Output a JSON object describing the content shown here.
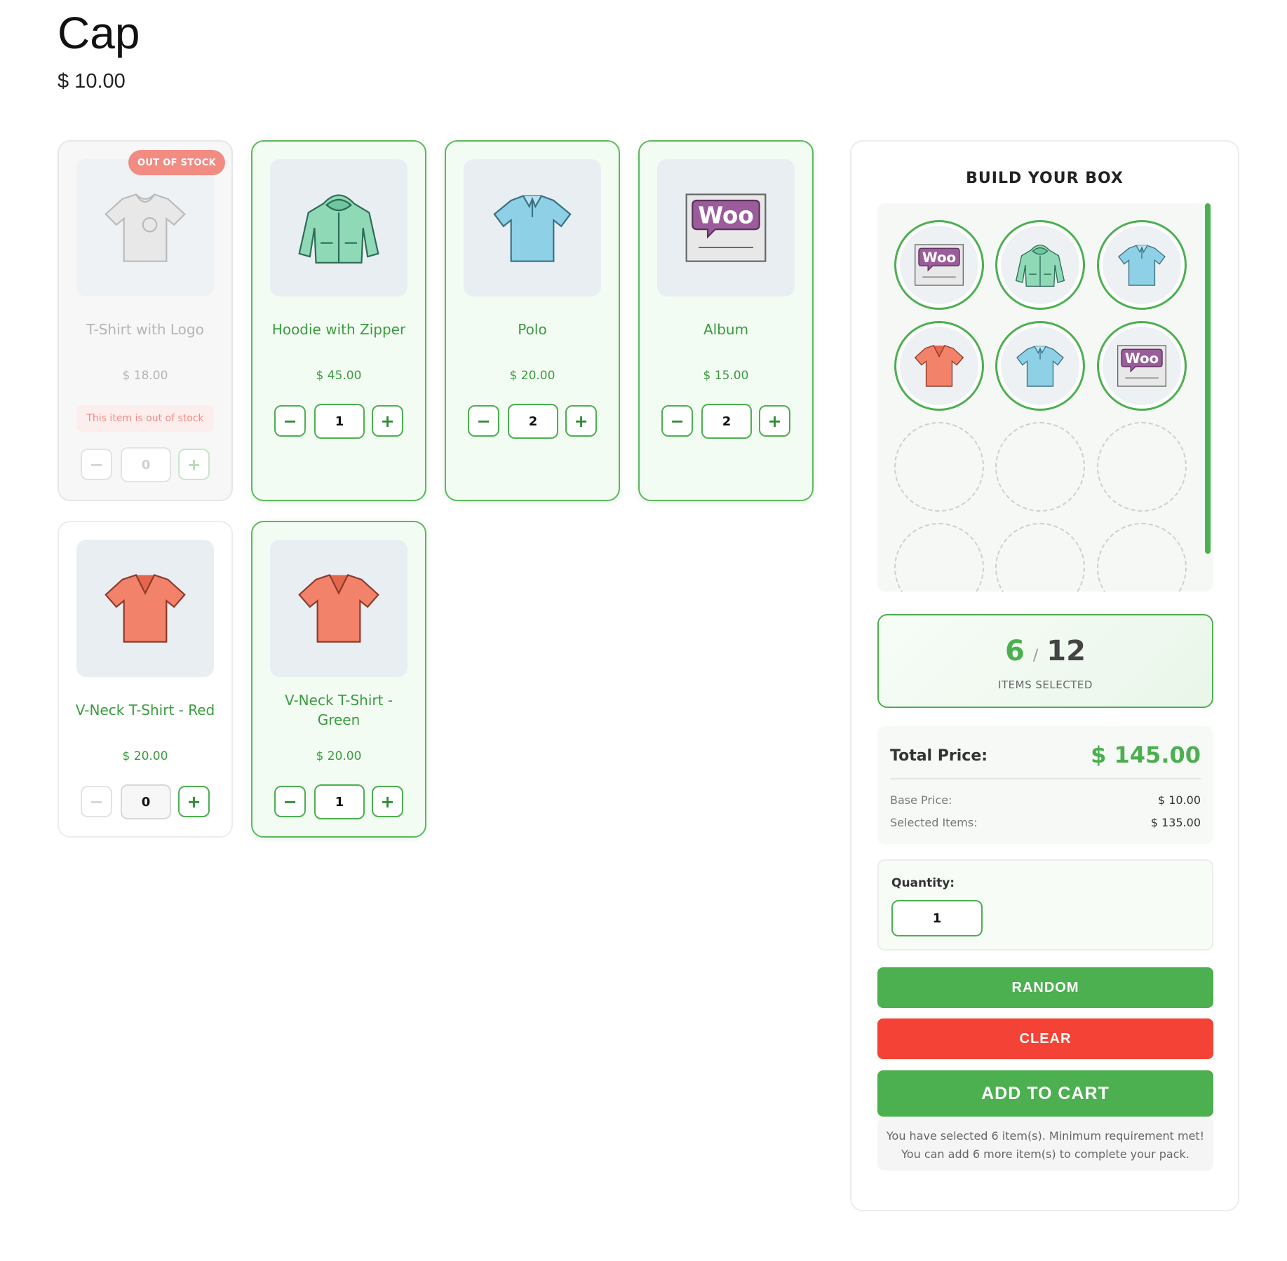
{
  "product": {
    "title": "Cap",
    "price": "$ 10.00"
  },
  "items": [
    {
      "name": "T-Shirt with Logo",
      "price": "$ 18.00",
      "qty": "0",
      "badge": "OUT OF STOCK",
      "note": "This item is out of stock"
    },
    {
      "name": "Hoodie with Zipper",
      "price": "$ 45.00",
      "qty": "1"
    },
    {
      "name": "Polo",
      "price": "$ 20.00",
      "qty": "2"
    },
    {
      "name": "Album",
      "price": "$ 15.00",
      "qty": "2"
    },
    {
      "name": "V-Neck T-Shirt - Red",
      "price": "$ 20.00",
      "qty": "0"
    },
    {
      "name": "V-Neck T-Shirt - Green",
      "price": "$ 20.00",
      "qty": "1"
    }
  ],
  "controls": {
    "minus": "−",
    "plus": "+"
  },
  "box": {
    "title": "BUILD YOUR BOX",
    "slots": [
      "album",
      "hoodie",
      "polo",
      "vneck-red",
      "polo",
      "album",
      "empty",
      "empty",
      "empty",
      "empty",
      "empty",
      "empty"
    ],
    "selected": "6",
    "max": "12",
    "slash": "/",
    "selected_label": "ITEMS SELECTED",
    "total_label": "Total Price:",
    "total_value": "$ 145.00",
    "base_label": "Base Price:",
    "base_value": "$ 10.00",
    "items_label": "Selected Items:",
    "items_value": "$ 135.00",
    "quantity_label": "Quantity:",
    "quantity_value": "1",
    "random_label": "RANDOM",
    "clear_label": "CLEAR",
    "cart_label": "ADD TO CART",
    "message_line1": "You have selected 6 item(s). Minimum requirement met!",
    "message_line2": "You can add 6 more item(s) to complete your pack."
  },
  "colors": {
    "accent": "#4caf50",
    "danger": "#f44336",
    "badge": "#f28b82"
  }
}
